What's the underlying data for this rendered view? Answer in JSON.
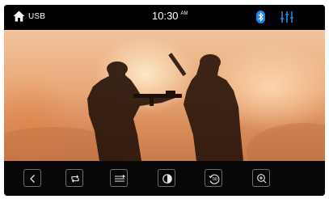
{
  "status_bar": {
    "source": "USB",
    "time": "10:30",
    "time_suffix": "AM",
    "home_icon": "home-icon",
    "bluetooth_icon": "bluetooth-icon",
    "equalizer_icon": "equalizer-icon",
    "accent_color": "#1e88e5"
  },
  "video": {
    "content": "video-frame"
  },
  "controls": [
    {
      "name": "back-button",
      "icon": "chevron-left-icon"
    },
    {
      "name": "repeat-button",
      "icon": "repeat-icon"
    },
    {
      "name": "playlist-button",
      "icon": "list-icon"
    },
    {
      "name": "brightness-button",
      "icon": "contrast-icon"
    },
    {
      "name": "rotate-button",
      "icon": "rotate-icon",
      "label": "90"
    },
    {
      "name": "zoom-button",
      "icon": "zoom-in-icon"
    }
  ]
}
